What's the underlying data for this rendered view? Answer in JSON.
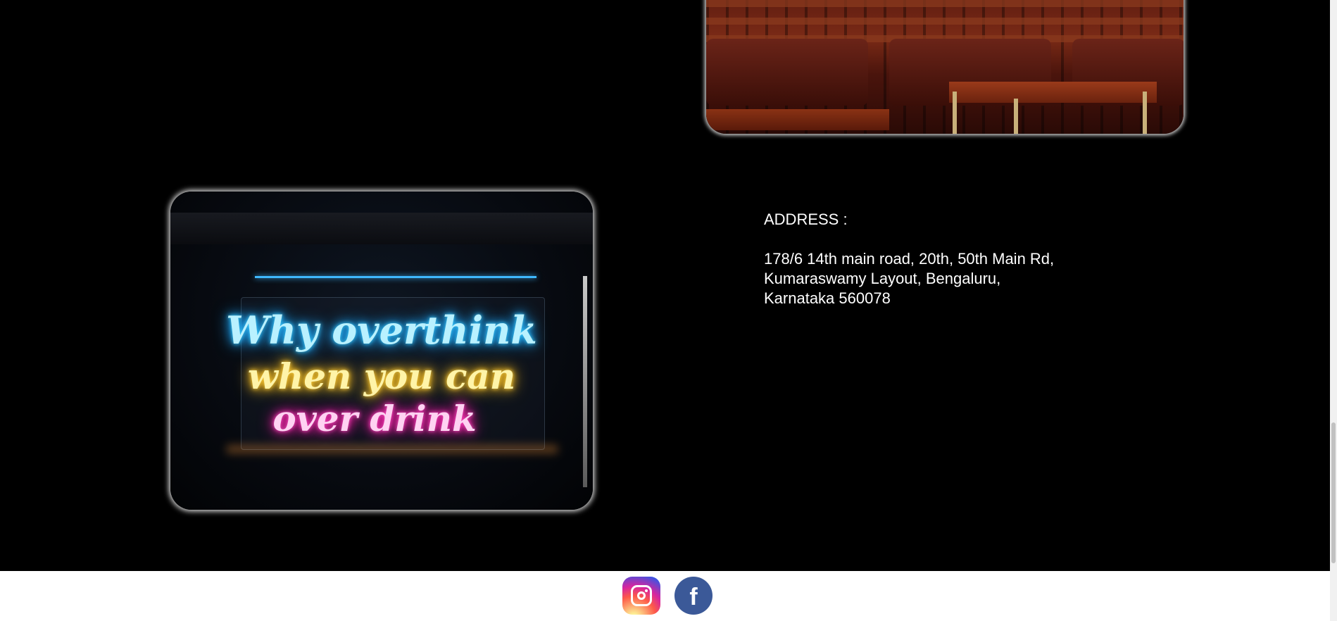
{
  "address": {
    "label": "ADDRESS :",
    "lines": [
      "178/6 14th main road, 20th, 50th Main Rd,",
      "Kumaraswamy Layout, Bengaluru,",
      "Karnataka 560078"
    ]
  },
  "neon_sign": {
    "lines": [
      "Why overthink",
      "when you can",
      "over drink"
    ]
  },
  "footer": {
    "social": [
      {
        "name": "instagram",
        "icon": "instagram-icon"
      },
      {
        "name": "facebook",
        "icon": "facebook-icon"
      }
    ]
  },
  "colors": {
    "background": "#000000",
    "footer": "#ffffff",
    "text": "#ffffff",
    "facebook": "#3b5998"
  }
}
